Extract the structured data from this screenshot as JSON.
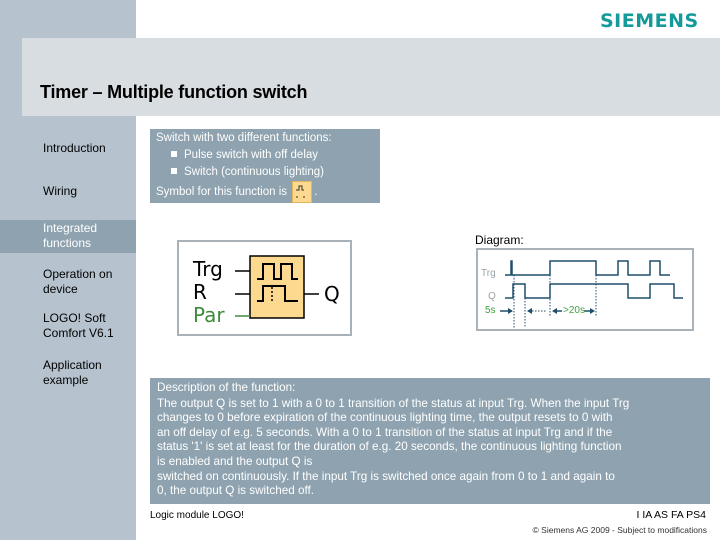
{
  "brand": {
    "logo_text": "SIEMENS",
    "color": "#159a9a"
  },
  "header": {
    "title": "Timer – Multiple function switch"
  },
  "sidebar": {
    "items": [
      {
        "label_lines": [
          "Introduction"
        ],
        "active": false
      },
      {
        "label_lines": [
          "Wiring"
        ],
        "active": false
      },
      {
        "label_lines": [
          "Integrated",
          "functions"
        ],
        "active": true
      },
      {
        "label_lines": [
          "Operation on",
          "device"
        ],
        "active": false
      },
      {
        "label_lines": [
          "LOGO! Soft",
          "Comfort V6.1"
        ],
        "active": false
      },
      {
        "label_lines": [
          "Application",
          "example"
        ],
        "active": false
      }
    ]
  },
  "intro": {
    "heading": "Switch with two different functions:",
    "bullets": [
      "Pulse switch with off delay",
      "Switch (continuous lighting)"
    ],
    "symbol_prefix": "Symbol for this function is",
    "symbol_suffix": ".",
    "symbol_icon": "multiple-function-switch-icon"
  },
  "function_block": {
    "inputs": [
      {
        "label": "Trg",
        "color": "#000000"
      },
      {
        "label": "R",
        "color": "#000000"
      },
      {
        "label": "Par",
        "color": "#3d8b3d"
      }
    ],
    "output": "Q",
    "block_color": "#fcd98e"
  },
  "diagram": {
    "title": "Diagram:",
    "signals": [
      {
        "label": "Trg"
      },
      {
        "label": "Q"
      }
    ],
    "annotations": {
      "off_delay": "5s",
      "long_press": ">20s"
    },
    "line_color": "#1f4e6b",
    "label_color": "#3fa23f"
  },
  "description": {
    "heading": "Description of the function:",
    "lines": [
      "The output Q is set to 1 with a 0 to 1 transition of the status at input Trg. When the input Trg",
      "changes to 0 before expiration of the continuous lighting time, the output resets to 0 with",
      "an off delay of e.g. 5 seconds. With a 0 to 1 transition of the status at input Trg and if the",
      "status '1' is set at least for the duration of e.g. 20 seconds, the continuous lighting function",
      "is enabled and the output Q is",
      "switched on continuously. If the input  Trg is switched once again from 0 to 1 and again to",
      "0, the output Q is switched off."
    ]
  },
  "footer": {
    "left": "Logic module LOGO!",
    "code": "I IA AS FA PS4",
    "copyright": "© Siemens AG 2009 - Subject to modifications"
  }
}
